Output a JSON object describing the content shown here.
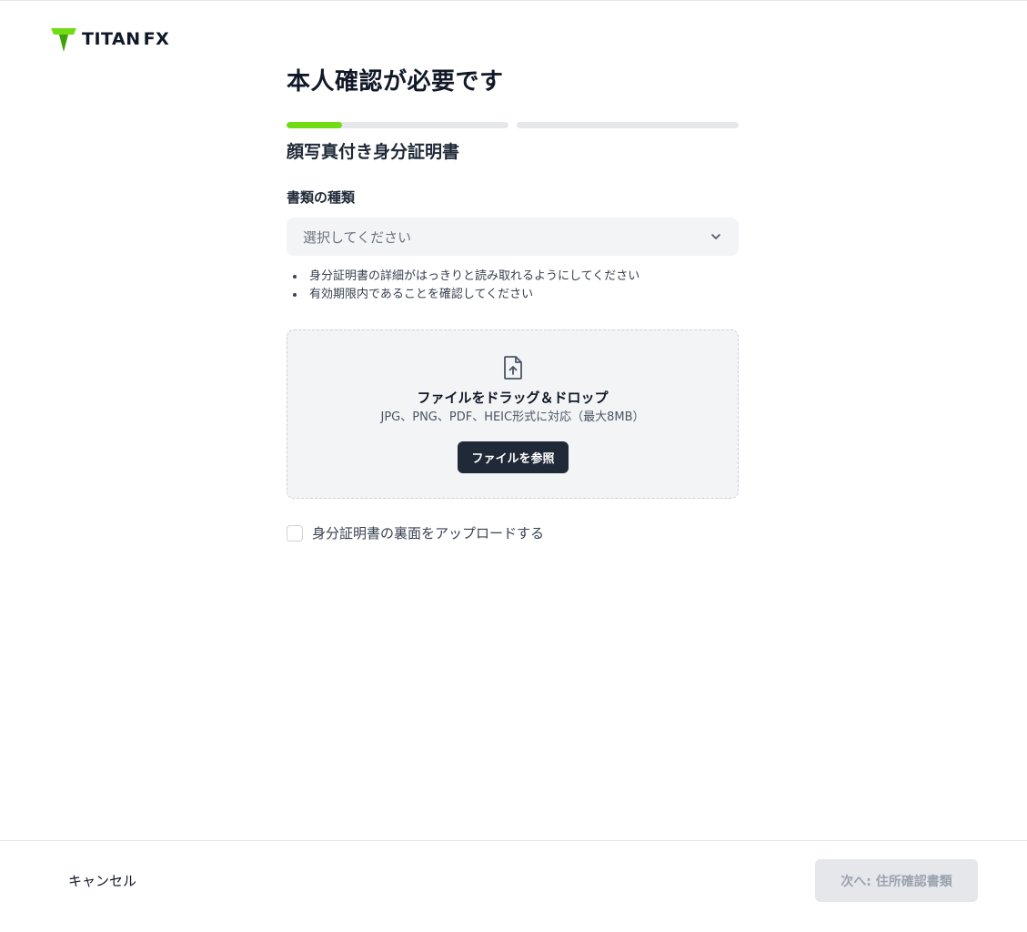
{
  "brand": {
    "logo_word": "TITAN",
    "logo_suffix": "FX",
    "accent_color": "#6fdd11"
  },
  "page": {
    "title": "本人確認が必要です"
  },
  "progress": {
    "steps": [
      {
        "fill_fraction": 0.25
      },
      {
        "fill_fraction": 0
      }
    ]
  },
  "section": {
    "title": "顔写真付き身分証明書"
  },
  "document_type": {
    "label": "書類の種類",
    "placeholder": "選択してください"
  },
  "hints": [
    "身分証明書の詳細がはっきりと読み取れるようにしてください",
    "有効期限内であることを確認してください"
  ],
  "dropzone": {
    "icon": "file-upload-icon",
    "title": "ファイルをドラッグ＆ドロップ",
    "subtitle": "JPG、PNG、PDF、HEIC形式に対応（最大8MB）",
    "browse_label": "ファイルを参照"
  },
  "back_side": {
    "label": "身分証明書の裏面をアップロードする",
    "checked": false
  },
  "footer": {
    "cancel_label": "キャンセル",
    "next_label": "次へ: 住所確認書類"
  }
}
